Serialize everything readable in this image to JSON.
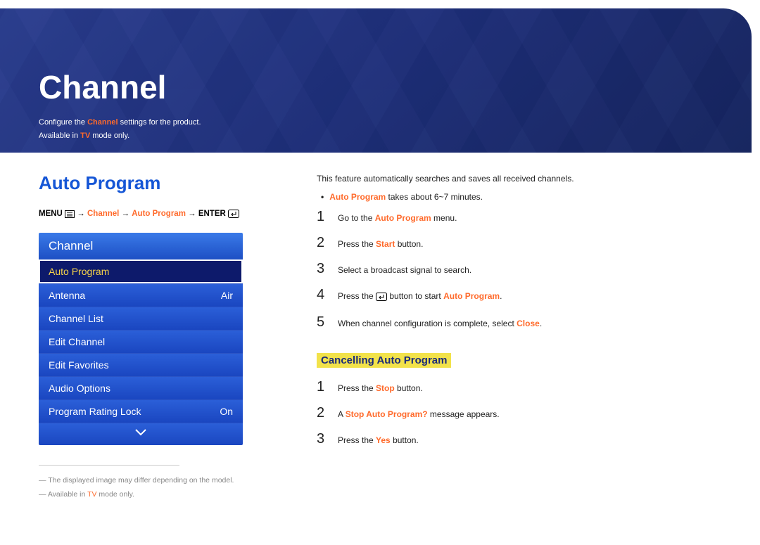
{
  "banner": {
    "title": "Channel",
    "sub_pre": "Configure the ",
    "sub_hl": "Channel",
    "sub_post": " settings for the product.",
    "sub2_pre": "Available in ",
    "sub2_hl": "TV",
    "sub2_post": " mode only."
  },
  "left": {
    "section_title": "Auto Program",
    "nav": {
      "menu_label": "MENU",
      "arrow": " → ",
      "p1": "Channel",
      "p2": "Auto Program",
      "enter_label": "ENTER"
    },
    "menu_header": "Channel",
    "items": [
      {
        "label": "Auto Program",
        "value": "",
        "selected": true
      },
      {
        "label": "Antenna",
        "value": "Air",
        "selected": false
      },
      {
        "label": "Channel List",
        "value": "",
        "selected": false
      },
      {
        "label": "Edit Channel",
        "value": "",
        "selected": false
      },
      {
        "label": "Edit Favorites",
        "value": "",
        "selected": false
      },
      {
        "label": "Audio Options",
        "value": "",
        "selected": false
      },
      {
        "label": "Program Rating Lock",
        "value": "On",
        "selected": false
      }
    ],
    "foot1": "The displayed image may differ depending on the model.",
    "foot2_pre": "Available in ",
    "foot2_hl": "TV",
    "foot2_post": " mode only."
  },
  "right": {
    "intro": "This feature automatically searches and saves all received channels.",
    "bullet_pre": "",
    "bullet_hl": "Auto Program",
    "bullet_post": " takes about 6~7 minutes.",
    "steps": [
      {
        "n": "1",
        "pre": "Go to the ",
        "hl": "Auto Program",
        "post": " menu."
      },
      {
        "n": "2",
        "pre": "Press the ",
        "hl": "Start",
        "post": " button."
      },
      {
        "n": "3",
        "pre": "Select a broadcast signal to search.",
        "hl": "",
        "post": ""
      },
      {
        "n": "4",
        "pre": "Press the ",
        "hl": "",
        "post": " button to start ",
        "hl2": "Auto Program",
        "post2": ".",
        "enter_icon": true
      },
      {
        "n": "5",
        "pre": "When channel configuration is complete, select ",
        "hl": "Close",
        "post": "."
      }
    ],
    "subhead": "Cancelling Auto Program",
    "steps2": [
      {
        "n": "1",
        "pre": "Press the ",
        "hl": "Stop",
        "post": " button."
      },
      {
        "n": "2",
        "pre": "A ",
        "hl": "Stop Auto Program?",
        "post": " message appears."
      },
      {
        "n": "3",
        "pre": "Press the ",
        "hl": "Yes",
        "post": " button."
      }
    ]
  }
}
